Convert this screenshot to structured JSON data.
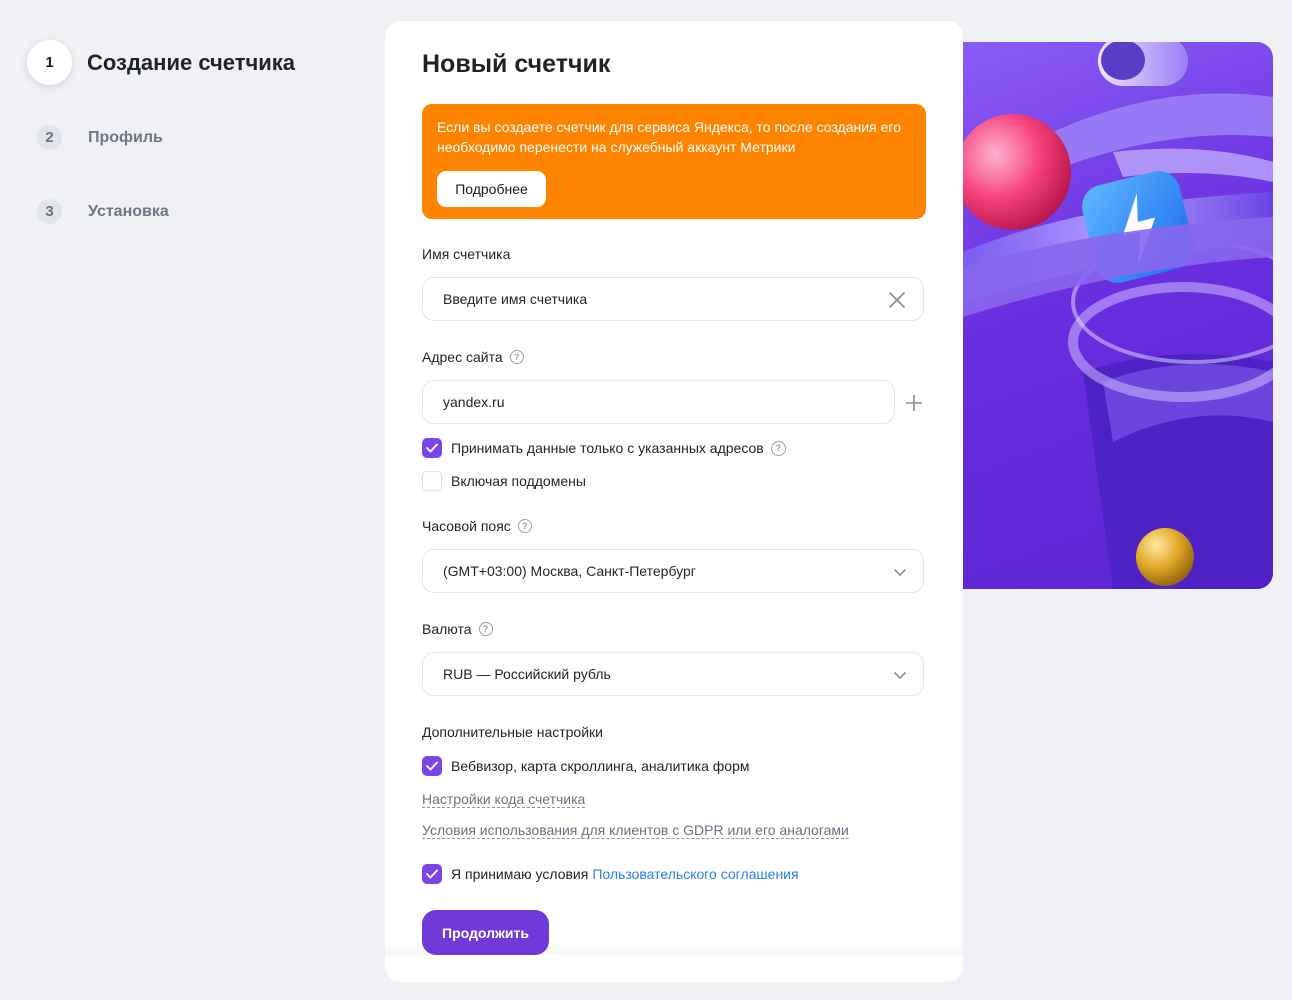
{
  "steps": [
    {
      "num": "1",
      "label": "Создание счетчика"
    },
    {
      "num": "2",
      "label": "Профиль"
    },
    {
      "num": "3",
      "label": "Установка"
    }
  ],
  "form": {
    "title": "Новый счетчик",
    "banner": {
      "text": "Если вы создаете счетчик для сервиса Яндекса, то после создания его необходимо перенести на служебный аккаунт Метрики",
      "button": "Подробнее",
      "color": "#fe8400"
    },
    "counter_name": {
      "label": "Имя счетчика",
      "value": "Введите имя счетчика"
    },
    "site": {
      "label": "Адрес сайта",
      "value": "yandex.ru",
      "only_listed_label": "Принимать данные только с указанных адресов",
      "only_listed_checked": true,
      "subdomains_label": "Включая поддомены",
      "subdomains_checked": false
    },
    "timezone": {
      "label": "Часовой пояс",
      "value": "(GMT+03:00) Москва, Санкт-Петербург"
    },
    "currency": {
      "label": "Валюта",
      "value": "RUB — Российский рубль"
    },
    "extra": {
      "label": "Дополнительные настройки",
      "webvisor_label": "Вебвизор, карта скроллинга, аналитика форм",
      "webvisor_checked": true,
      "code_settings_link": "Настройки кода счетчика",
      "gdpr_link": "Условия использования для клиентов с GDPR или его аналогами"
    },
    "agreement": {
      "text": "Я принимаю условия",
      "link": "Пользовательского соглашения",
      "checked": true
    },
    "continue_button": "Продолжить"
  },
  "colors": {
    "accent": "#7b46e8",
    "button": "#6f3ad9",
    "link": "#2b80e8",
    "banner": "#fe8400"
  },
  "icons": {
    "help": "?",
    "clear": "close-icon",
    "add": "plus-icon",
    "dropdown": "chevron-down-icon",
    "check": "checkmark-icon"
  }
}
